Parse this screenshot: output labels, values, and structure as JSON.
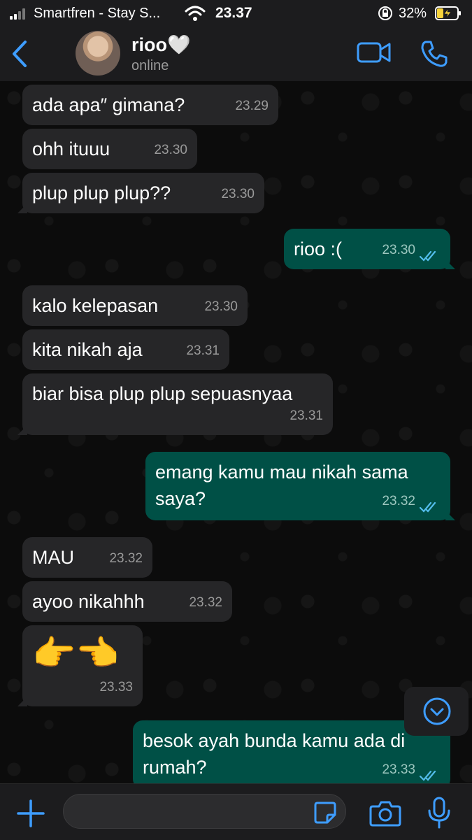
{
  "status_bar": {
    "carrier": "Smartfren - Stay S...",
    "time": "23.37",
    "battery_percent": "32%",
    "battery_level": 0.32
  },
  "header": {
    "contact_name": "rioo🤍",
    "contact_status": "online"
  },
  "colors": {
    "accent": "#3e9dff",
    "incoming_bubble": "#262628",
    "outgoing_bubble": "#005046",
    "read_ticks": "#53bdeb"
  },
  "messages": [
    {
      "dir": "in",
      "text": "ada apa″ gimana?",
      "time": "23.29"
    },
    {
      "dir": "in",
      "text": "ohh ituuu",
      "time": "23.30"
    },
    {
      "dir": "in",
      "text": "plup plup plup??",
      "time": "23.30"
    },
    {
      "dir": "out",
      "text": "rioo :(",
      "time": "23.30",
      "read": true
    },
    {
      "dir": "in",
      "text": "kalo kelepasan",
      "time": "23.30"
    },
    {
      "dir": "in",
      "text": "kita nikah aja",
      "time": "23.31"
    },
    {
      "dir": "in",
      "text": "biar bisa plup plup sepuasnyaa",
      "time": "23.31"
    },
    {
      "dir": "out",
      "text": "emang kamu mau nikah sama saya?",
      "time": "23.32",
      "read": true
    },
    {
      "dir": "in",
      "text": "MAU",
      "time": "23.32"
    },
    {
      "dir": "in",
      "text": "ayoo nikahhh",
      "time": "23.32"
    },
    {
      "dir": "in",
      "text": "👉👈",
      "time": "23.33"
    },
    {
      "dir": "out",
      "text": "besok ayah bunda kamu ada di rumah?",
      "time": "23.33",
      "read": true
    }
  ],
  "icons": {
    "back": "chevron-left-icon",
    "video": "video-camera-icon",
    "call": "phone-icon",
    "scroll": "chevron-down-circle-icon",
    "add": "plus-icon",
    "sticker": "sticker-icon",
    "camera": "camera-icon",
    "mic": "microphone-icon"
  }
}
